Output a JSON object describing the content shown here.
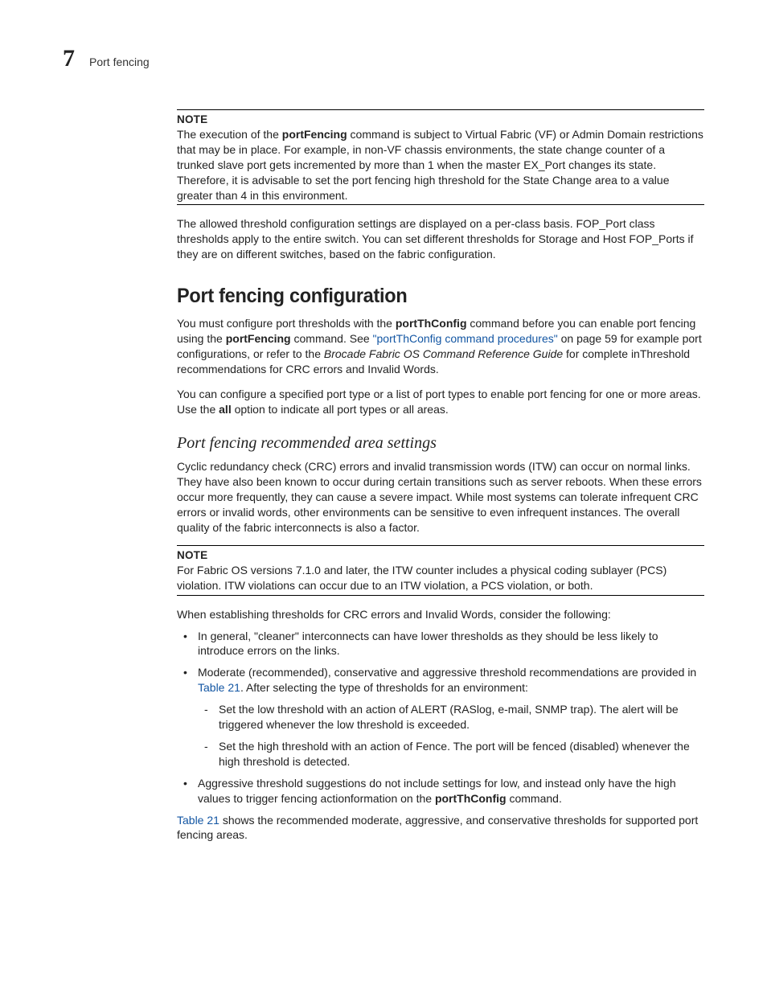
{
  "header": {
    "chapter_number": "7",
    "chapter_title": "Port fencing"
  },
  "note1": {
    "label": "NOTE",
    "text_pre": "The execution of the ",
    "cmd": "portFencing",
    "text_post": " command is subject to Virtual Fabric (VF) or Admin Domain restrictions that may be in place. For example, in non-VF chassis environments, the state change counter of a trunked slave port gets incremented by more than 1 when the master EX_Port changes its state. Therefore, it is advisable to set the port fencing high threshold for the State Change area to a value greater than 4 in this environment."
  },
  "para1": "The allowed threshold configuration settings are displayed on a per-class basis. FOP_Port class thresholds apply to the entire switch. You can set different thresholds for Storage and Host FOP_Ports if they are on different switches, based on the fabric configuration.",
  "h2": "Port fencing configuration",
  "para2": {
    "t1": "You must configure port thresholds with the ",
    "b1": "portThConfig",
    "t2": " command before you can enable port fencing using the ",
    "b2": "portFencing",
    "t3": " command. See ",
    "link": "\"portThConfig command procedures\"",
    "t4": " on page 59 for example port configurations, or refer to the ",
    "i1": "Brocade Fabric OS Command Reference Guide",
    "t5": " for complete inThreshold recommendations for CRC errors and Invalid Words."
  },
  "para3": {
    "t1": "You can configure a specified port type or a list of port types to enable port fencing for one or more areas. Use the ",
    "b1": "all",
    "t2": " option to indicate all port types or all areas."
  },
  "h3": "Port fencing recommended area settings",
  "para4": "Cyclic redundancy check (CRC) errors and invalid transmission words (ITW) can occur on normal links. They have also been known to occur during certain transitions such as server reboots. When these errors occur more frequently, they can cause a severe impact. While most systems can tolerate infrequent CRC errors or invalid words, other environments can be sensitive to even infrequent instances. The overall quality of the fabric interconnects is also a factor.",
  "note2": {
    "label": "NOTE",
    "text": "For Fabric OS versions 7.1.0 and later, the ITW counter includes a physical coding sublayer (PCS) violation. ITW violations can occur due to an ITW violation, a PCS violation, or both."
  },
  "para5": "When establishing thresholds for CRC errors and Invalid Words, consider the following:",
  "bullets": {
    "b1": "In general, \"cleaner\" interconnects can have lower thresholds as they should be less likely to introduce errors on the links.",
    "b2_t1": "Moderate (recommended), conservative and aggressive threshold recommendations are provided in ",
    "b2_link": "Table 21",
    "b2_t2": ". After selecting the type of thresholds for an environment:",
    "d1": "Set the low threshold with an action of ALERT (RASlog, e-mail, SNMP trap). The alert will be triggered whenever the low threshold is exceeded.",
    "d2": "Set the high threshold with an action of Fence. The port will be fenced (disabled) whenever the high threshold is detected.",
    "b3_t1": "Aggressive threshold suggestions do not include settings for low, and instead only have the high values to trigger fencing actionformation on the ",
    "b3_bold": "portThConfig",
    "b3_t2": " command."
  },
  "para6": {
    "link": "Table 21",
    "t1": " shows the recommended moderate, aggressive, and conservative thresholds for supported port fencing areas."
  }
}
